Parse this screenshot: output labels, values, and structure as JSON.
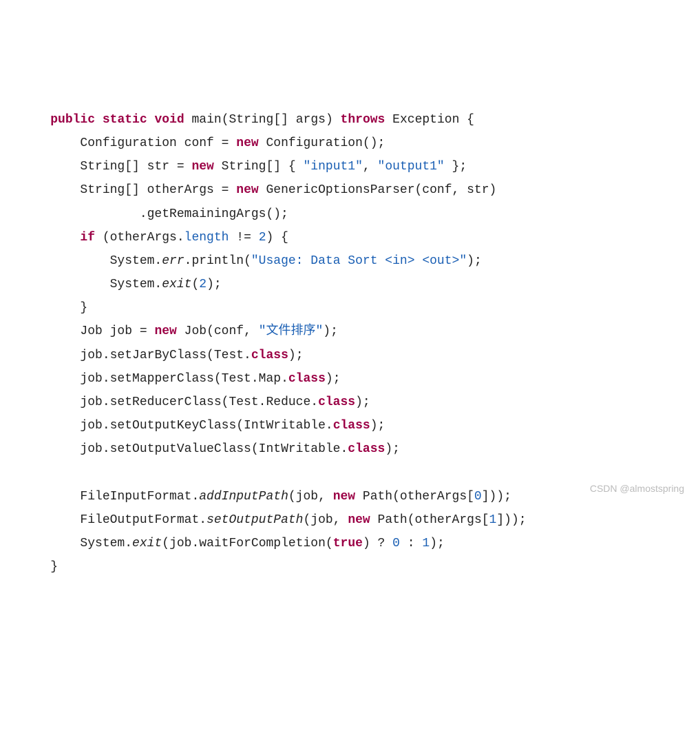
{
  "code": {
    "l1": {
      "kw1": "public",
      "kw2": "static",
      "kw3": "void",
      "name": "main",
      "args": "(String[] args) ",
      "kw4": "throws",
      "rest": " Exception {"
    },
    "l2": {
      "text1": "Configuration conf = ",
      "kw": "new",
      "text2": " Configuration();"
    },
    "l3": {
      "text1": "String[] str = ",
      "kw": "new",
      "text2": " String[] { ",
      "s1": "\"input1\"",
      "c": ", ",
      "s2": "\"output1\"",
      "text3": " };"
    },
    "l4": {
      "text1": "String[] otherArgs = ",
      "kw": "new",
      "text2": " GenericOptionsParser(conf, str)"
    },
    "l5": {
      "text": ".getRemainingArgs();"
    },
    "l6": {
      "kw": "if",
      "text1": " (otherArgs.",
      "field": "length",
      "text2": " != ",
      "num": "2",
      "text3": ") {"
    },
    "l7": {
      "text1": "System.",
      "m": "err",
      "text2": ".println(",
      "s": "\"Usage: Data Sort <in> <out>\"",
      "text3": ");"
    },
    "l8": {
      "text1": "System.",
      "m": "exit",
      "text2": "(",
      "num": "2",
      "text3": ");"
    },
    "l9": {
      "text": "}"
    },
    "l10": {
      "text1": "Job job = ",
      "kw": "new",
      "text2": " Job(conf, ",
      "s": "\"文件排序\"",
      "text3": ");"
    },
    "l11": {
      "text1": "job.setJarByClass(Test.",
      "kw": "class",
      "text2": ");"
    },
    "l12": {
      "text1": "job.setMapperClass(Test.Map.",
      "kw": "class",
      "text2": ");"
    },
    "l13": {
      "text1": "job.setReducerClass(Test.Reduce.",
      "kw": "class",
      "text2": ");"
    },
    "l14": {
      "text1": "job.setOutputKeyClass(IntWritable.",
      "kw": "class",
      "text2": ");"
    },
    "l15": {
      "text1": "job.setOutputValueClass(IntWritable.",
      "kw": "class",
      "text2": ");"
    },
    "l16": {
      "text": ""
    },
    "l17": {
      "text1": "FileInputFormat.",
      "m": "addInputPath",
      "text2": "(job, ",
      "kw": "new",
      "text3": " Path(otherArgs[",
      "num": "0",
      "text4": "]));"
    },
    "l18": {
      "text1": "FileOutputFormat.",
      "m": "setOutputPath",
      "text2": "(job, ",
      "kw": "new",
      "text3": " Path(otherArgs[",
      "num": "1",
      "text4": "]));"
    },
    "l19": {
      "text1": "System.",
      "m": "exit",
      "text2": "(job.waitForCompletion(",
      "kw": "true",
      "text3": ") ? ",
      "n1": "0",
      "text4": " : ",
      "n2": "1",
      "text5": ");"
    },
    "l20": {
      "text": "}"
    }
  },
  "indent": {
    "i1": "    ",
    "i2": "        ",
    "i3": "            ",
    "i4": "                "
  },
  "watermark": "CSDN @almostspring"
}
